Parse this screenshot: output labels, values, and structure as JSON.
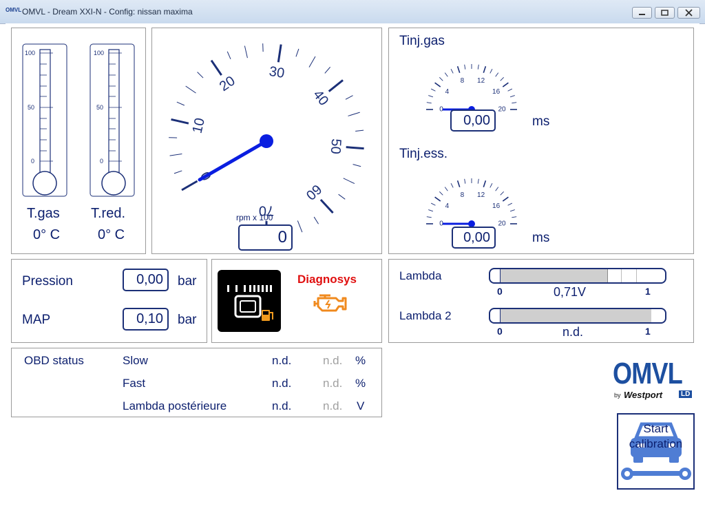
{
  "window": {
    "title": "OMVL - Dream XXI-N - Config: nissan maxima",
    "app_icon": "OMVL",
    "controls": [
      "minimize-icon",
      "maximize-icon",
      "close-icon"
    ]
  },
  "thermometers": [
    {
      "label": "T.gas",
      "value": "0° C",
      "scale": [
        "100",
        "50",
        "0"
      ],
      "level_percent": 0
    },
    {
      "label": "T.red.",
      "value": "0° C",
      "scale": [
        "100",
        "50",
        "0"
      ],
      "level_percent": 0
    }
  ],
  "rpm_gauge": {
    "unit": "rpm x 100",
    "value": "0",
    "scale": [
      "0",
      "10",
      "20",
      "30",
      "40",
      "50",
      "60",
      "70"
    ],
    "needle_value": 0
  },
  "tinj": [
    {
      "label": "Tinj.gas",
      "value": "0,00",
      "unit": "ms",
      "scale": [
        "0",
        "4",
        "8",
        "12",
        "16",
        "20"
      ],
      "needle_value": 0
    },
    {
      "label": "Tinj.ess.",
      "value": "0,00",
      "unit": "ms",
      "scale": [
        "0",
        "4",
        "8",
        "12",
        "16",
        "20"
      ],
      "needle_value": 0
    }
  ],
  "pressure": {
    "pression_label": "Pression",
    "pression_value": "0,00",
    "pression_unit": "bar",
    "map_label": "MAP",
    "map_value": "0,10",
    "map_unit": "bar"
  },
  "diagnosys": {
    "label": "Diagnosys",
    "switch_icon": "fuel-switch-icon",
    "engine_icon": "engine-check-icon"
  },
  "lambda": [
    {
      "label": "Lambda",
      "min": "0",
      "max": "1",
      "reading": "0,71V",
      "fill_fraction": 0.71
    },
    {
      "label": "Lambda 2",
      "min": "0",
      "max": "1",
      "reading": "n.d.",
      "fill_fraction": 1.0
    }
  ],
  "obd": {
    "title": "OBD status",
    "rows": [
      {
        "name": "Slow",
        "value": "n.d.",
        "value2": "n.d.",
        "unit": "%"
      },
      {
        "name": "Fast",
        "value": "n.d.",
        "value2": "n.d.",
        "unit": "%"
      },
      {
        "name": "Lambda postérieure",
        "value": "n.d.",
        "value2": "n.d.",
        "unit": "V"
      }
    ]
  },
  "brand": {
    "logo": "OMVL",
    "by": "by",
    "partner": "Westport",
    "partner_suffix": "LD"
  },
  "calibration": {
    "label_line1": "Start",
    "label_line2": "calibration",
    "icon": "car-wrench-icon"
  },
  "colors": {
    "navy": "#0c1f6e",
    "needle": "#0a1ee0",
    "diagnosys_red": "#e01010",
    "engine_orange": "#f08a1e"
  }
}
